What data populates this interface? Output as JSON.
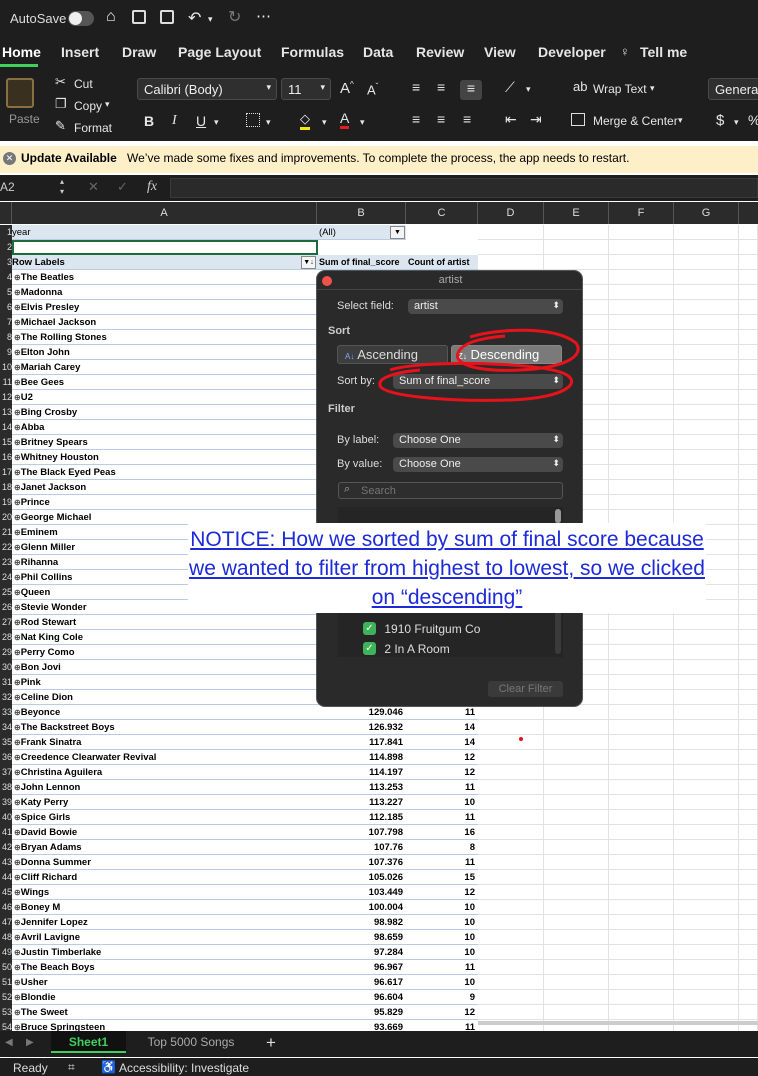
{
  "quick_access": {
    "autosave_label": "AutoSave"
  },
  "tabs": [
    "Home",
    "Insert",
    "Draw",
    "Page Layout",
    "Formulas",
    "Data",
    "Review",
    "View",
    "Developer",
    "Tell me"
  ],
  "ribbon": {
    "paste": "Paste",
    "cut": "Cut",
    "copy": "Copy",
    "format": "Format",
    "font_name": "Calibri (Body)",
    "font_size": "11",
    "bold": "B",
    "italic": "I",
    "underline": "U",
    "wrap_text": "Wrap Text",
    "merge_center": "Merge & Center",
    "number_format": "General"
  },
  "update_bar": {
    "title": "Update Available",
    "message": "We’ve made some fixes and improvements. To complete the process, the app needs to restart."
  },
  "formula_bar": {
    "name_box": "A2",
    "fx": "fx"
  },
  "columns": [
    "A",
    "B",
    "C",
    "D",
    "E",
    "F",
    "G"
  ],
  "pivot": {
    "filter_label": "year",
    "filter_value": "(All)",
    "header_row_labels": "Row Labels",
    "header_sum": "Sum of final_score",
    "header_count": "Count of artist"
  },
  "row_numbers": [
    "1",
    "2",
    "3",
    "4",
    "5",
    "6",
    "7",
    "8",
    "9",
    "10",
    "11",
    "12",
    "13",
    "14",
    "15",
    "16",
    "17",
    "18",
    "19",
    "20",
    "21",
    "22",
    "23",
    "24",
    "25",
    "26",
    "27",
    "28",
    "29",
    "30",
    "31",
    "32",
    "33",
    "34",
    "35",
    "36",
    "37",
    "38",
    "39",
    "40",
    "41",
    "42",
    "43",
    "44",
    "45",
    "46",
    "47",
    "48",
    "49",
    "50",
    "51",
    "52",
    "53",
    "54"
  ],
  "artists": [
    {
      "name": "The Beatles",
      "sum": "",
      "count": ""
    },
    {
      "name": "Madonna",
      "sum": "",
      "count": ""
    },
    {
      "name": "Elvis Presley",
      "sum": "",
      "count": ""
    },
    {
      "name": "Michael Jackson",
      "sum": "",
      "count": ""
    },
    {
      "name": "The Rolling Stones",
      "sum": "",
      "count": ""
    },
    {
      "name": "Elton John",
      "sum": "",
      "count": ""
    },
    {
      "name": "Mariah Carey",
      "sum": "",
      "count": ""
    },
    {
      "name": "Bee Gees",
      "sum": "",
      "count": ""
    },
    {
      "name": "U2",
      "sum": "",
      "count": ""
    },
    {
      "name": "Bing Crosby",
      "sum": "",
      "count": ""
    },
    {
      "name": "Abba",
      "sum": "",
      "count": ""
    },
    {
      "name": "Britney Spears",
      "sum": "",
      "count": ""
    },
    {
      "name": "Whitney Houston",
      "sum": "",
      "count": ""
    },
    {
      "name": "The Black Eyed Peas",
      "sum": "",
      "count": ""
    },
    {
      "name": "Janet Jackson",
      "sum": "",
      "count": ""
    },
    {
      "name": "Prince",
      "sum": "",
      "count": ""
    },
    {
      "name": "George Michael",
      "sum": "",
      "count": ""
    },
    {
      "name": "Eminem",
      "sum": "",
      "count": ""
    },
    {
      "name": "Glenn Miller",
      "sum": "",
      "count": ""
    },
    {
      "name": "Rihanna",
      "sum": "",
      "count": ""
    },
    {
      "name": "Phil Collins",
      "sum": "",
      "count": ""
    },
    {
      "name": "Queen",
      "sum": "",
      "count": ""
    },
    {
      "name": "Stevie Wonder",
      "sum": "",
      "count": ""
    },
    {
      "name": "Rod Stewart",
      "sum": "",
      "count": ""
    },
    {
      "name": "Nat King Cole",
      "sum": "",
      "count": ""
    },
    {
      "name": "Perry Como",
      "sum": "",
      "count": ""
    },
    {
      "name": "Bon Jovi",
      "sum": "",
      "count": ""
    },
    {
      "name": "Pink",
      "sum": "",
      "count": ""
    },
    {
      "name": "Celine Dion",
      "sum": "",
      "count": ""
    },
    {
      "name": "Beyonce",
      "sum": "129.046",
      "count": "11"
    },
    {
      "name": "The Backstreet Boys",
      "sum": "126.932",
      "count": "14"
    },
    {
      "name": "Frank Sinatra",
      "sum": "117.841",
      "count": "14"
    },
    {
      "name": "Creedence Clearwater Revival",
      "sum": "114.898",
      "count": "12"
    },
    {
      "name": "Christina Aguilera",
      "sum": "114.197",
      "count": "12"
    },
    {
      "name": "John Lennon",
      "sum": "113.253",
      "count": "11"
    },
    {
      "name": "Katy Perry",
      "sum": "113.227",
      "count": "10"
    },
    {
      "name": "Spice Girls",
      "sum": "112.185",
      "count": "11"
    },
    {
      "name": "David Bowie",
      "sum": "107.798",
      "count": "16"
    },
    {
      "name": "Bryan Adams",
      "sum": "107.76",
      "count": "8"
    },
    {
      "name": "Donna Summer",
      "sum": "107.376",
      "count": "11"
    },
    {
      "name": "Cliff Richard",
      "sum": "105.026",
      "count": "15"
    },
    {
      "name": "Wings",
      "sum": "103.449",
      "count": "12"
    },
    {
      "name": "Boney M",
      "sum": "100.004",
      "count": "10"
    },
    {
      "name": "Jennifer Lopez",
      "sum": "98.982",
      "count": "10"
    },
    {
      "name": "Avril Lavigne",
      "sum": "98.659",
      "count": "10"
    },
    {
      "name": "Justin Timberlake",
      "sum": "97.284",
      "count": "10"
    },
    {
      "name": "The Beach Boys",
      "sum": "96.967",
      "count": "11"
    },
    {
      "name": "Usher",
      "sum": "96.617",
      "count": "10"
    },
    {
      "name": "Blondie",
      "sum": "96.604",
      "count": "9"
    },
    {
      "name": "The Sweet",
      "sum": "95.829",
      "count": "12"
    },
    {
      "name": "Bruce Springsteen",
      "sum": "93.669",
      "count": "11"
    }
  ],
  "popup": {
    "title": "artist",
    "select_field_label": "Select field:",
    "select_field_value": "artist",
    "sort_heading": "Sort",
    "ascending": "Ascending",
    "descending": "Descending",
    "sort_by_label": "Sort by:",
    "sort_by_value": "Sum of final_score",
    "filter_heading": "Filter",
    "by_label": "By label:",
    "by_label_value": "Choose One",
    "by_value": "By value:",
    "by_value_value": "Choose One",
    "search_placeholder": "Search",
    "list_items": [
      "1910 Fruitgum Co",
      "2 In A Room"
    ],
    "clear_filter": "Clear Filter"
  },
  "notice": "NOTICE: How we sorted by sum of final score because we wanted to filter from highest to lowest, so we clicked on “descending”",
  "sheet_tabs": [
    "Sheet1",
    "Top 5000 Songs"
  ],
  "status": {
    "ready": "Ready",
    "accessibility": "Accessibility: Investigate"
  },
  "colors": {
    "annotation": "#e8121b",
    "notice_text": "#1d2ad8",
    "active_tab": "#3fd05e"
  }
}
